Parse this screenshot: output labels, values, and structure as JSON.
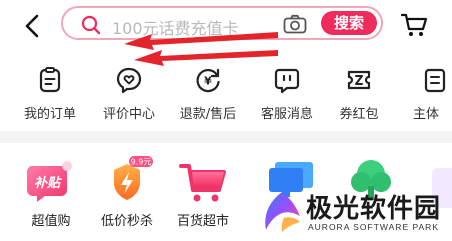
{
  "search": {
    "placeholder": "100元话费充值卡",
    "button_label": "搜索"
  },
  "quick_links": [
    {
      "label": "我的订单",
      "icon": "order-icon"
    },
    {
      "label": "评价中心",
      "icon": "review-icon"
    },
    {
      "label": "退款/售后",
      "icon": "refund-icon"
    },
    {
      "label": "客服消息",
      "icon": "service-chat-icon"
    },
    {
      "label": "券红包",
      "icon": "coupon-icon"
    },
    {
      "label": "主体",
      "icon": "entity-icon"
    }
  ],
  "services": [
    {
      "label": "超值购",
      "icon": "subsidy-icon",
      "icon_text": "补贴"
    },
    {
      "label": "低价秒杀",
      "icon": "flash-sale-icon",
      "badge": "9.9元"
    },
    {
      "label": "百货超市",
      "icon": "supermarket-cart-icon"
    },
    {
      "label": "",
      "icon": "monitor-icon"
    },
    {
      "label": "",
      "icon": "tree-icon"
    }
  ],
  "watermark": {
    "title": "极光软件园",
    "subtitle": "AURORA SOFTWARE PARK"
  },
  "colors": {
    "accent": "#ef2b5c",
    "search_border": "#f0a7b6",
    "annotation_red": "#e3242b"
  }
}
